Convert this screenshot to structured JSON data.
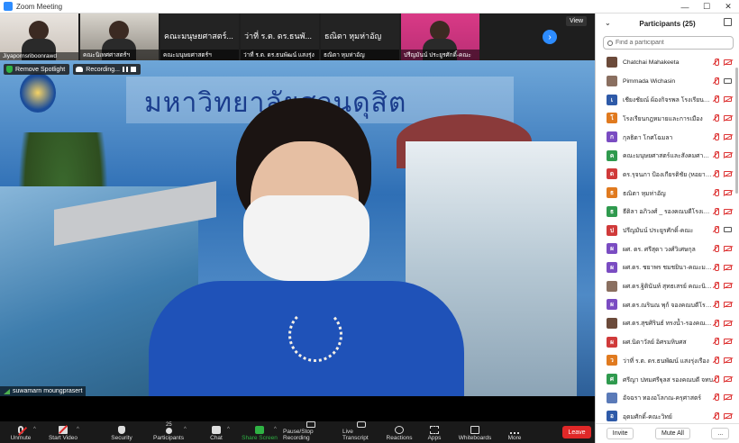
{
  "window": {
    "title": "Zoom Meeting",
    "minimize": "—",
    "maximize": "☐",
    "close": "✕"
  },
  "gallery": {
    "tiles": [
      {
        "name": "Jiyapornsriboonrawd",
        "style": "photo"
      },
      {
        "name": "คณะนิเทศศาสตร์ฯ",
        "style": "photo2"
      },
      {
        "name": "คณะมนุษยศาสตร์ฯ",
        "big": "คณะมนุษยศาสตร์...",
        "style": "dark"
      },
      {
        "name": "ว่าที่ ร.ต. ดร.ธนพัฒน์ แสงรุ่ง",
        "big": "ว่าที่ ร.ต. ดร.ธนพั...",
        "style": "dark"
      },
      {
        "name": "ธณิตา หุมห่าอัญ",
        "big": "ธณิตา หุมห่าอัญ",
        "style": "dark"
      },
      {
        "name": "ปรีญมันน์ ประยูรศักดิ์-คณะ",
        "style": "pink"
      }
    ],
    "next_glyph": "›",
    "view_label": "View"
  },
  "spotlight": {
    "remove_label": "Remove Spotlight",
    "recording_label": "Recording...",
    "banner_text": "มหาวิทยาลัยสวนดุสิต",
    "speaker": "suwamarn moungprasert"
  },
  "toolbar": {
    "unmute": "Unmute",
    "start_video": "Start Video",
    "security": "Security",
    "participants": "Participants",
    "participants_count": "25",
    "chat": "Chat",
    "share": "Share Screen",
    "record": "Pause/Stop Recording",
    "transcript": "Live Transcript",
    "cc_glyph": "CC",
    "reactions": "Reactions",
    "apps": "Apps",
    "whiteboards": "Whiteboards",
    "more": "More",
    "leave": "Leave",
    "caret": "^"
  },
  "panel": {
    "title": "Participants (25)",
    "collapse_glyph": "⌄",
    "search_placeholder": "Find a participant",
    "invite": "Invite",
    "mute_all": "Mute All",
    "more": "...",
    "participants": [
      {
        "name": "Chatchai Mahakeeta",
        "initial": "",
        "color": "#6b4a3a",
        "video": "off"
      },
      {
        "name": "Pimmada Wichasin",
        "initial": "",
        "color": "#8a6f60",
        "video": "on"
      },
      {
        "name": "เชียงชัยณ์ ผ้องกิจรพล โรงเรียนการท่...",
        "initial": "เ",
        "color": "#2e5aa8",
        "video": "off"
      },
      {
        "name": "โรงเรียนกฎหมายและการเมือง",
        "initial": "โ",
        "color": "#e07a1f",
        "video": "off"
      },
      {
        "name": "กุลธิดา โกศโฉมลา",
        "initial": "ก",
        "color": "#7a4cc2",
        "video": "off"
      },
      {
        "name": "คณะมนุษยศาสตร์และสังคมศาสตร์",
        "initial": "ค",
        "color": "#2f9a4e",
        "video": "off"
      },
      {
        "name": "ดร.รุจนภา ป้องเกียรติชัย (หอยาลา)",
        "initial": "ด",
        "color": "#d03a3a",
        "video": "off"
      },
      {
        "name": "ธณิตา หุมห่าอัญ",
        "initial": "ธ",
        "color": "#e07a1f",
        "video": "off"
      },
      {
        "name": "ธีติลา อภิวงศ์ _ รองคณบดีโรงเรียนก...",
        "initial": "ธ",
        "color": "#2f9a4e",
        "video": "off"
      },
      {
        "name": "ปรีญมันน์ ประยูรศักดิ์-คณะ",
        "initial": "ป",
        "color": "#d03a3a",
        "video": "on"
      },
      {
        "name": "ผศ. ดร. ศรีสุดา วงศ์วิเศษกุล",
        "initial": "ผ",
        "color": "#7a4cc2",
        "video": "off"
      },
      {
        "name": "ผศ.ดร. ชยาพร ชมชยินา-คณะมนุษย...",
        "initial": "ผ",
        "color": "#7a4cc2",
        "video": "off"
      },
      {
        "name": "ผศ.ดร.ฐิตินันท์ สุทธเสรย์ คณะนิติศาส...",
        "initial": "",
        "color": "#8a6f60",
        "video": "off"
      },
      {
        "name": "ผศ.ดร.ณรินณ พุก้ จองคณบดีโรงเรีย...",
        "initial": "ผ",
        "color": "#7a4cc2",
        "video": "off"
      },
      {
        "name": "ผศ.ดร.สุขศิรินธ์ ทรงน้ำ-รองคณบดีอัก...",
        "initial": "",
        "color": "#6b4a3a",
        "video": "off"
      },
      {
        "name": "ผศ.นิดาวัลย์ อิศรมหิบศส",
        "initial": "ผ",
        "color": "#d03a3a",
        "video": "off"
      },
      {
        "name": "ว่าที่ ร.ต. ดร.ธนพัฒน์ แสงรุ่งเรือง",
        "initial": "ว",
        "color": "#e07a1f",
        "video": "off"
      },
      {
        "name": "ศรีญา ปทมศรีฐุลส รองคณบดี จทบ",
        "initial": "ศ",
        "color": "#2f9a4e",
        "video": "off"
      },
      {
        "name": "อัจฉรา ทองอโลกณ-ครุศาสตร์",
        "initial": "",
        "color": "#5a7ab8",
        "video": "off"
      },
      {
        "name": "อุดมศักดิ์-คณะวิทย์",
        "initial": "อ",
        "color": "#2e5aa8",
        "video": "off"
      }
    ]
  }
}
